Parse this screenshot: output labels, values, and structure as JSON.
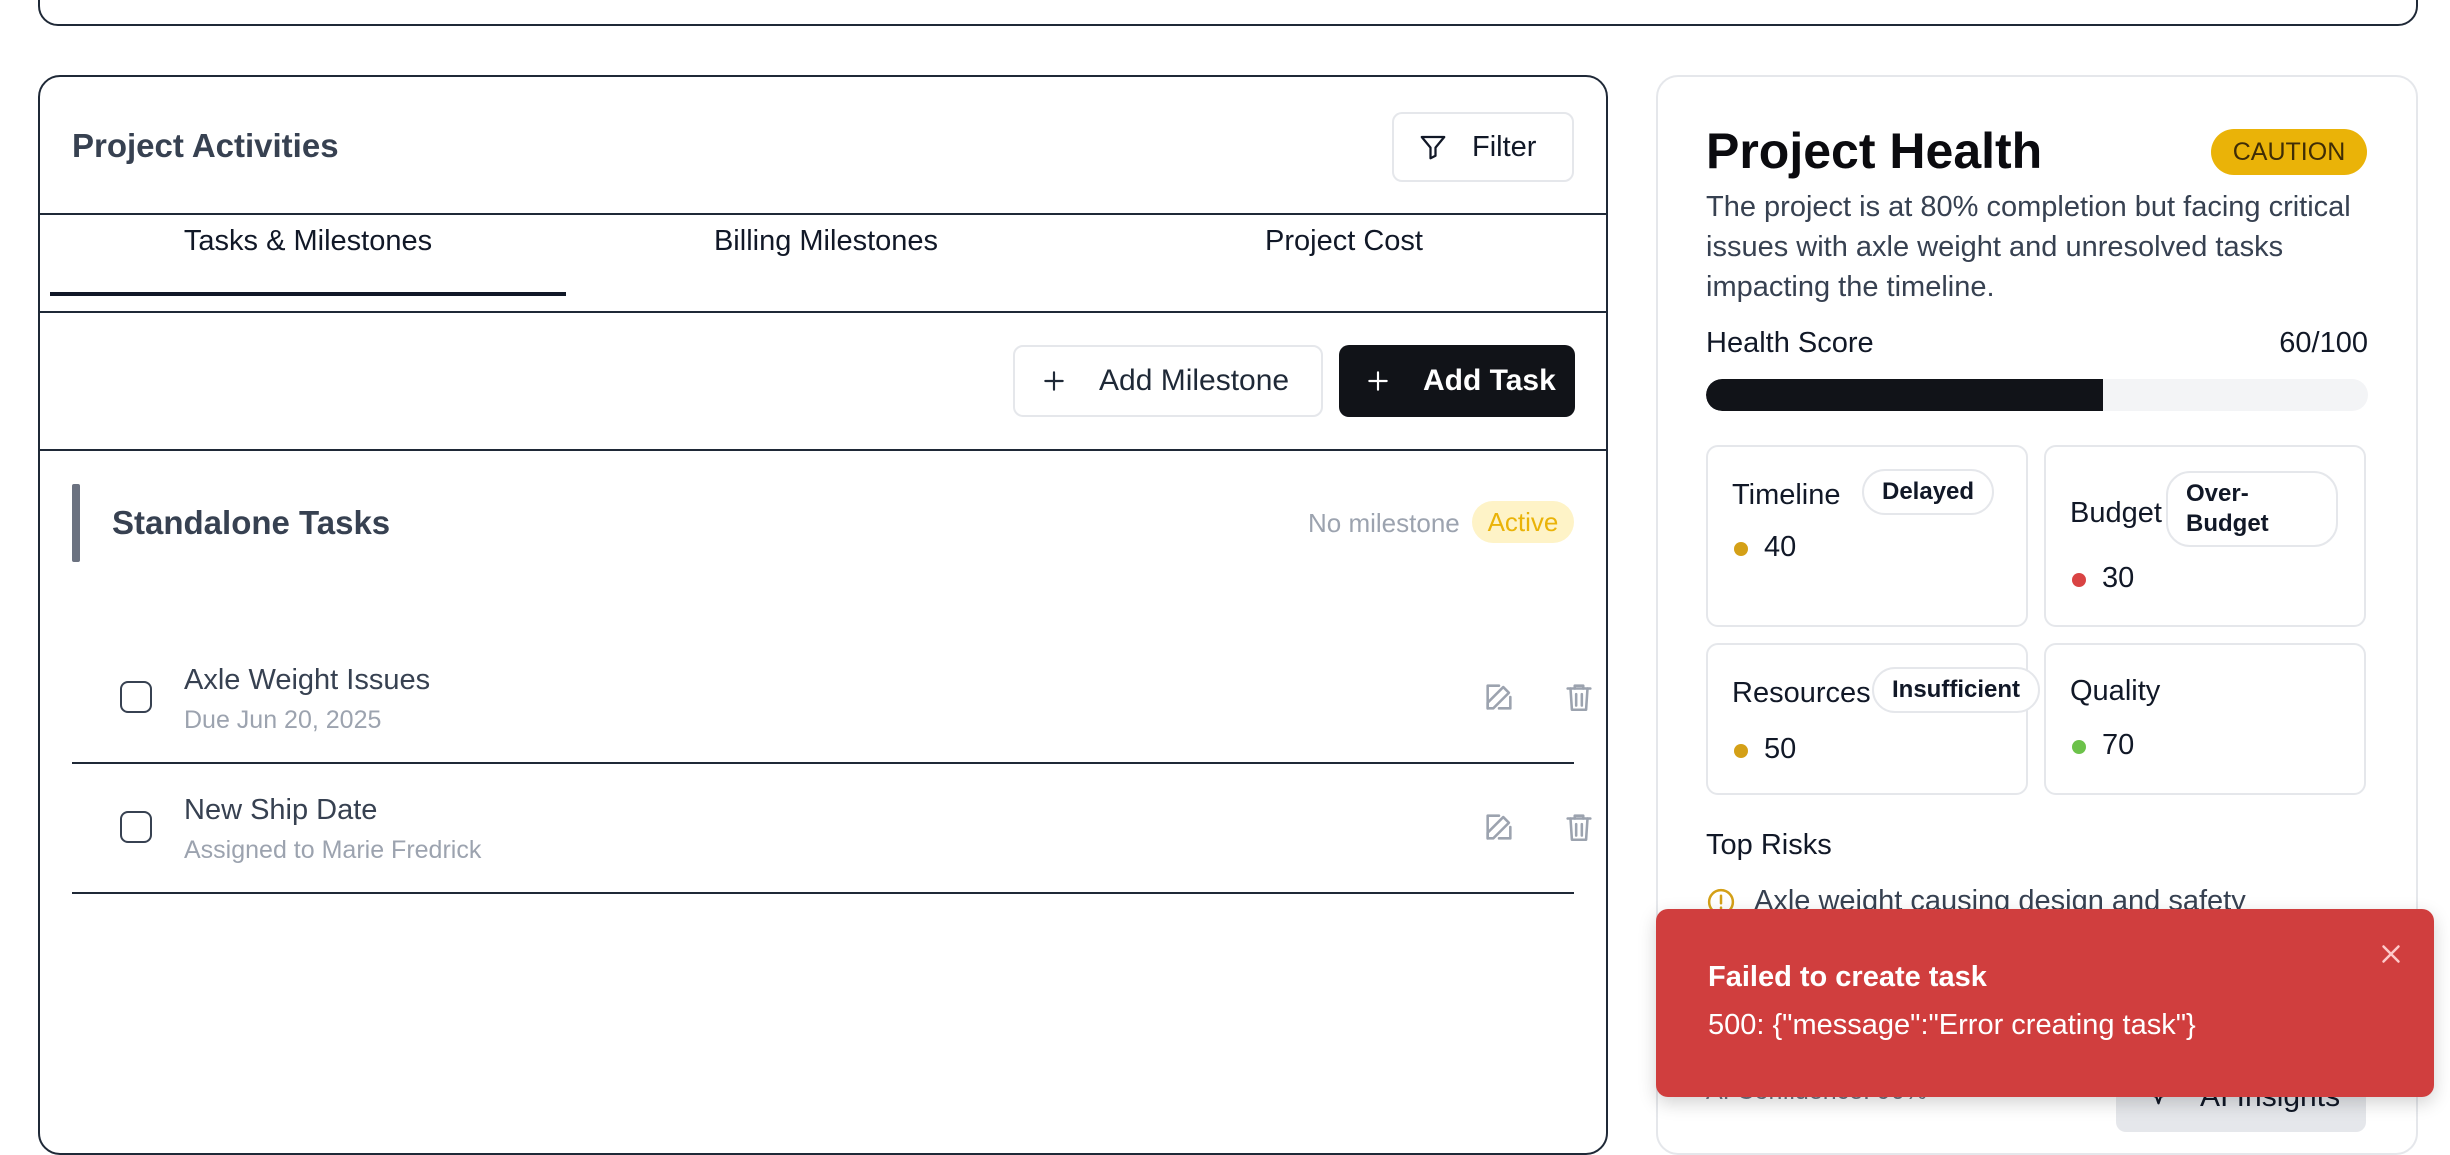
{
  "activities": {
    "title": "Project Activities",
    "filter_label": "Filter",
    "tabs": [
      {
        "label": "Tasks & Milestones",
        "active": true
      },
      {
        "label": "Billing Milestones",
        "active": false
      },
      {
        "label": "Project Cost",
        "active": false
      }
    ],
    "add_milestone_label": "Add Milestone",
    "add_task_label": "Add Task",
    "group": {
      "title": "Standalone Tasks",
      "meta": "No milestone",
      "status": "Active"
    },
    "tasks": [
      {
        "name": "Axle Weight Issues",
        "sub": "Due Jun 20, 2025"
      },
      {
        "name": "New Ship Date",
        "sub": "Assigned to Marie Fredrick"
      }
    ]
  },
  "health": {
    "title": "Project Health",
    "status_badge": "CAUTION",
    "description": "The project is at 80% completion but facing critical issues with axle weight and unresolved tasks impacting the timeline.",
    "score_label": "Health Score",
    "score_text": "60/100",
    "score_fraction": 0.6,
    "metrics": [
      {
        "name": "Timeline",
        "pill": "Delayed",
        "value": "40",
        "dot_color": "#d4a017"
      },
      {
        "name": "Budget",
        "pill": "Over-Budget",
        "value": "30",
        "dot_color": "#d94343"
      },
      {
        "name": "Resources",
        "pill": "Insufficient",
        "value": "50",
        "dot_color": "#d4a017"
      },
      {
        "name": "Quality",
        "pill": "",
        "value": "70",
        "dot_color": "#6cc24a"
      }
    ],
    "top_risks_title": "Top Risks",
    "risks": [
      "Axle weight causing design and safety"
    ],
    "ai_confidence": "AI Confidence: 90%",
    "ai_button_label": "AI Insights"
  },
  "toast": {
    "title": "Failed to create task",
    "message": "500: {\"message\":\"Error creating task\"}"
  },
  "colors": {
    "accent_dark": "#111318",
    "caution": "#eab308",
    "error": "#d03e3e"
  }
}
